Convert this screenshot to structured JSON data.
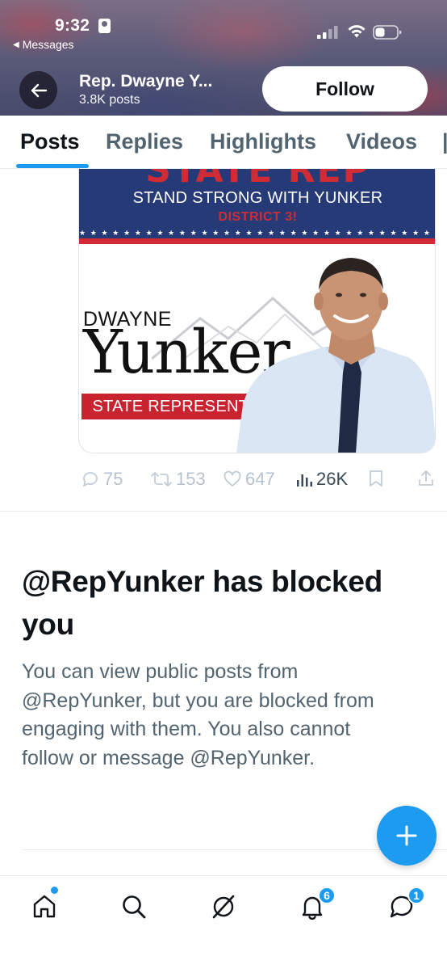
{
  "status_bar": {
    "time": "9:32",
    "back_app_label": "Messages"
  },
  "header": {
    "profile_name": "Rep. Dwayne Y...",
    "posts_count": "3.8K posts",
    "follow_label": "Follow"
  },
  "tabs": [
    {
      "label": "Posts",
      "active": true
    },
    {
      "label": "Replies",
      "active": false
    },
    {
      "label": "Highlights",
      "active": false
    },
    {
      "label": "Videos",
      "active": false
    }
  ],
  "post": {
    "media": {
      "banner_heading": "STATE REP",
      "tagline": "STAND STRONG WITH YUNKER",
      "district": "DISTRICT 3!",
      "first_name": "DWAYNE",
      "last_name": "Yunker",
      "office": "STATE REPRESENTATIVE"
    },
    "actions": {
      "replies": "75",
      "reposts": "153",
      "likes": "647",
      "views": "26K"
    }
  },
  "blocked_notice": {
    "title": "@RepYunker has blocked you",
    "body": "You can view public posts from @RepYunker, but you are blocked from engaging with them. You also cannot follow or message @RepYunker."
  },
  "bottom_nav": {
    "notifications_badge": "6",
    "messages_badge": "1"
  },
  "colors": {
    "accent": "#1d9bf0",
    "text_primary": "#0f1419",
    "text_secondary": "#536471",
    "banner_navy": "#263a78",
    "banner_red": "#d12c36"
  }
}
